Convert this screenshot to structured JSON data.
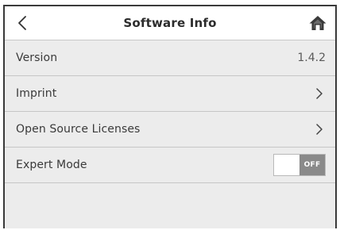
{
  "header": {
    "title": "Software Info",
    "back_icon": "chevron-left-icon",
    "home_icon": "home-icon"
  },
  "rows": [
    {
      "label": "Version",
      "value": "1.4.2"
    },
    {
      "label": "Imprint",
      "icon": "chevron-right-icon"
    },
    {
      "label": "Open Source Licenses",
      "icon": "chevron-right-icon"
    },
    {
      "label": "Expert Mode",
      "toggle_state": "OFF",
      "toggle_on": false
    }
  ],
  "colors": {
    "background": "#ececec",
    "header": "#ffffff",
    "toggle_off": "#8a8a8a",
    "frame_border": "#3a3a3a"
  }
}
